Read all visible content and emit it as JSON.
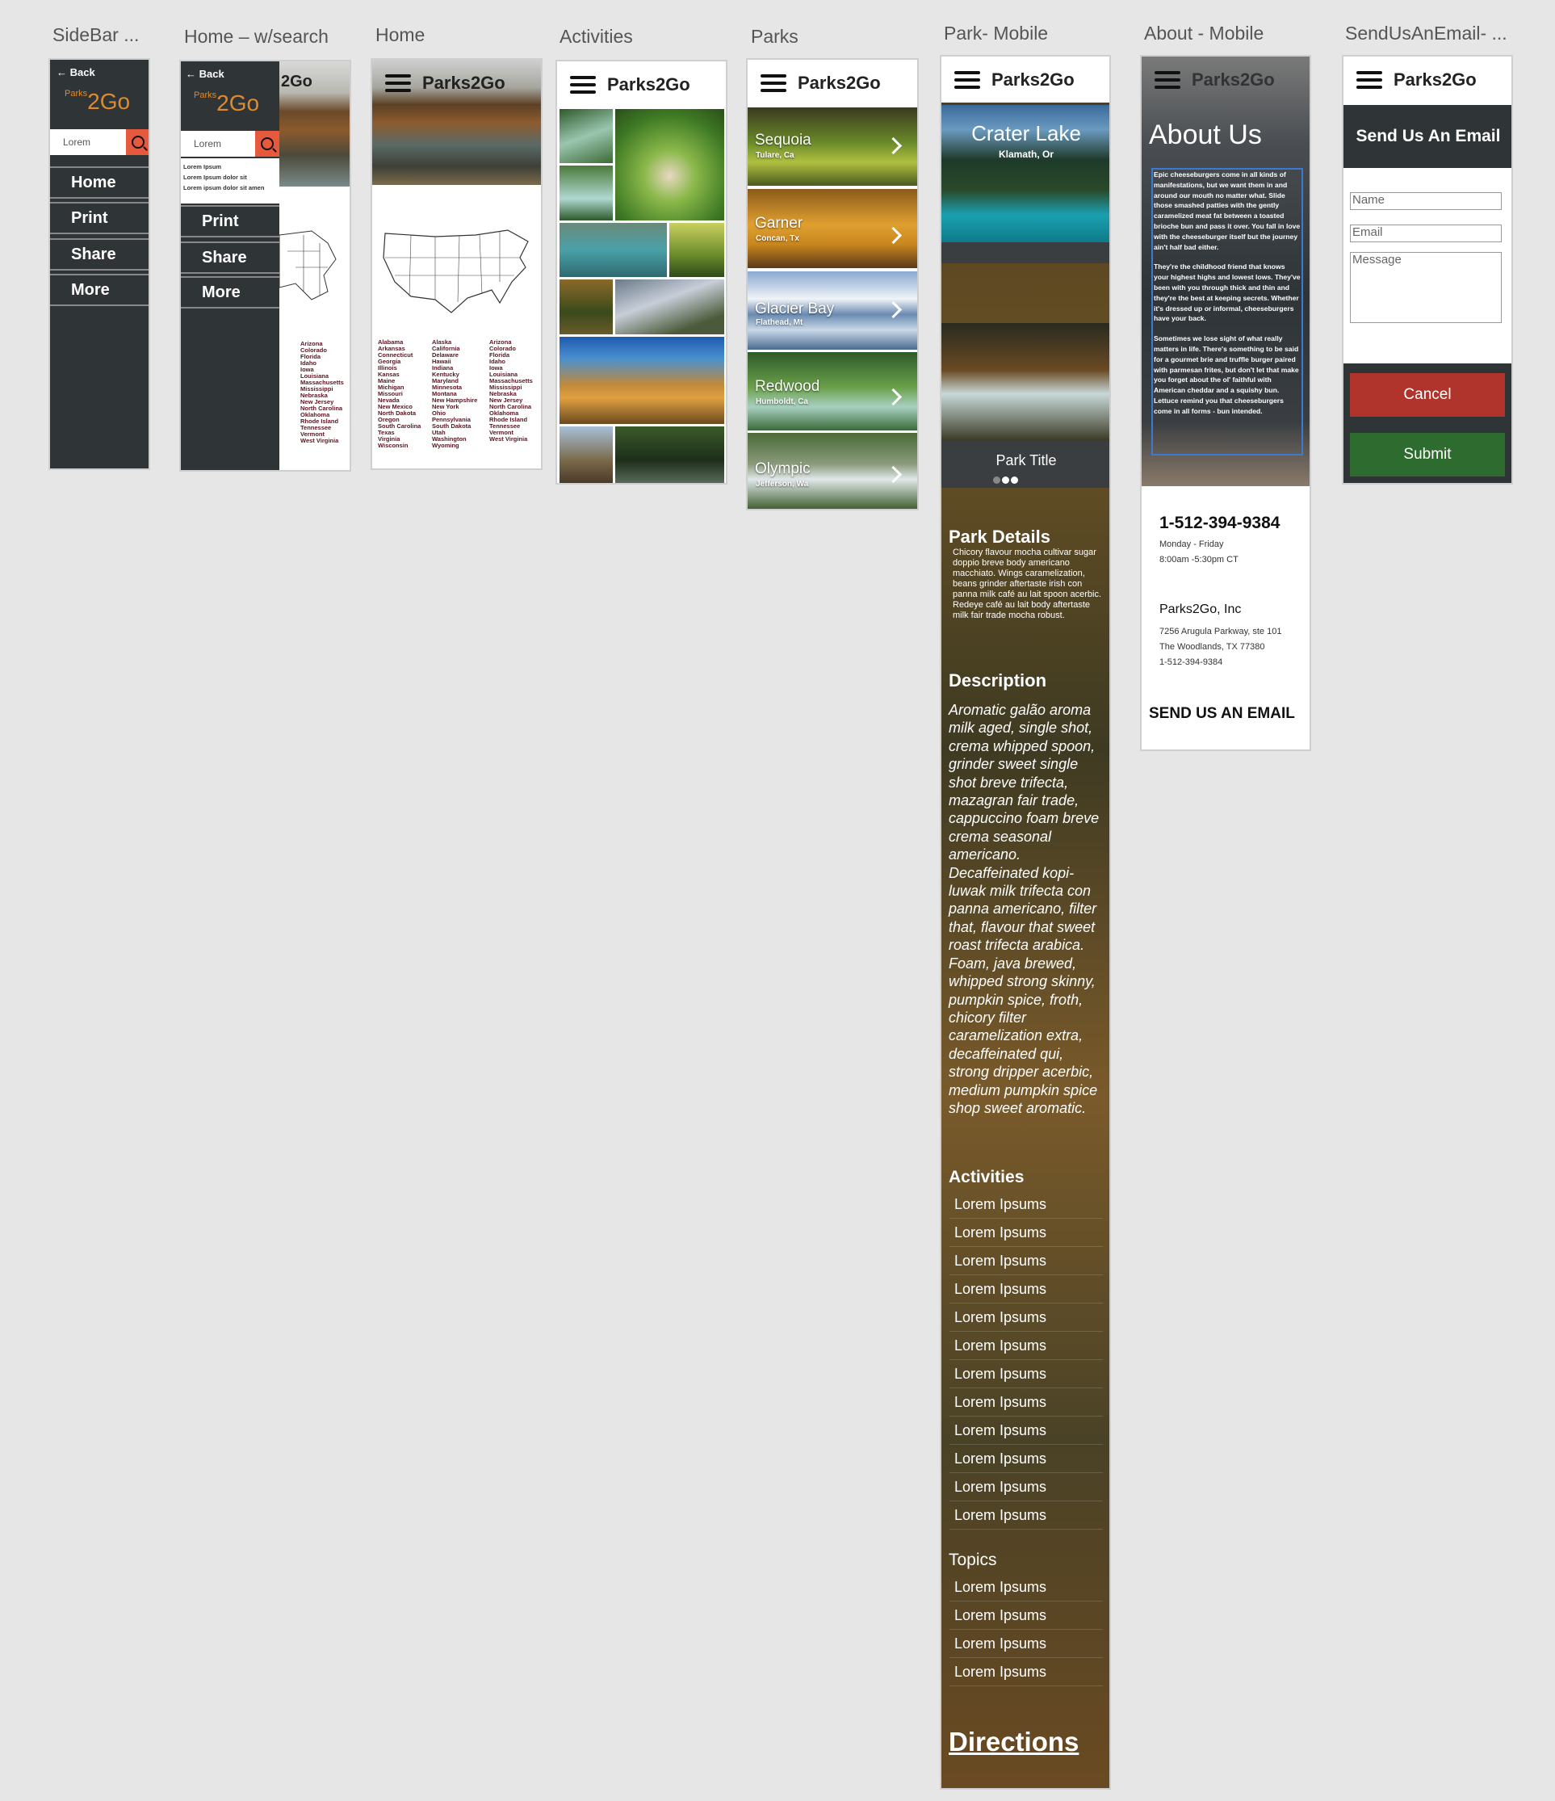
{
  "artboards": {
    "sidebar": "SideBar ...",
    "home_search": "Home – w/search",
    "home": "Home",
    "activities": "Activities",
    "parks": "Parks",
    "park_mobile": "Park- Mobile",
    "about_mobile": "About - Mobile",
    "send_email": "SendUsAnEmail- ..."
  },
  "brand": "Parks2Go",
  "logo": {
    "small": "Parks",
    "big": "2Go"
  },
  "sidebar": {
    "back": "Back",
    "search_value": "Lorem",
    "items": [
      "Home",
      "Print",
      "Share",
      "More"
    ],
    "results": [
      "Lorem Ipsum",
      "Lorem Ipsum dolor sit",
      "Lorem ipsum dolor sit amen"
    ],
    "partial_brand": "2Go"
  },
  "states": {
    "col1": [
      "Alabama",
      "Arkansas",
      "Connecticut",
      "Georgia",
      "Illinois",
      "Kansas",
      "Maine",
      "Michigan",
      "Missouri",
      "Nevada",
      "New Mexico",
      "North Dakota",
      "Oregon",
      "South Carolina",
      "Texas",
      "Virginia",
      "Wisconsin"
    ],
    "col2": [
      "Alaska",
      "California",
      "Delaware",
      "Hawaii",
      "Indiana",
      "Kentucky",
      "Maryland",
      "Minnesota",
      "Montana",
      "New Hampshire",
      "New York",
      "Ohio",
      "Pennsylvania",
      "South Dakota",
      "Utah",
      "Washington",
      "Wyoming"
    ],
    "col3": [
      "Arizona",
      "Colorado",
      "Florida",
      "Idaho",
      "Iowa",
      "Louisiana",
      "Massachusetts",
      "Mississippi",
      "Nebraska",
      "New Jersey",
      "North Carolina",
      "Oklahoma",
      "Rhode Island",
      "Tennessee",
      "Vermont",
      "West Virginia"
    ]
  },
  "parks": [
    {
      "name": "Sequoia",
      "loc": "Tulare, Ca"
    },
    {
      "name": "Garner",
      "loc": "Concan, Tx"
    },
    {
      "name": "Glacier Bay",
      "loc": "Flathead, Mt"
    },
    {
      "name": "Redwood",
      "loc": "Humboldt, Ca"
    },
    {
      "name": "Olympic",
      "loc": "Jefferson, Wa"
    }
  ],
  "park_mobile": {
    "hero_title": "Crater Lake",
    "hero_sub": "Klamath, Or",
    "carousel_title": "Park Title",
    "details_h": "Park Details",
    "details": "Chicory flavour mocha cultivar sugar doppio breve body americano macchiato. Wings caramelization, beans grinder aftertaste irish con panna milk café au lait spoon acerbic. Redeye café au lait body aftertaste milk fair trade mocha robust.",
    "desc_h": "Description",
    "desc": "Aromatic galão aroma milk aged, single shot, crema whipped spoon, grinder sweet single shot breve trifecta, mazagran fair trade, cappuccino foam breve crema seasonal americano. Decaffeinated kopi-luwak milk trifecta con panna americano, filter that, flavour that sweet roast trifecta arabica. Foam, java brewed, whipped strong skinny, pumpkin spice, froth, chicory filter caramelization extra, decaffeinated qui, strong dripper acerbic, medium pumpkin spice shop sweet aromatic.",
    "activities_h": "Activities",
    "activities": [
      "Lorem Ipsums",
      "Lorem Ipsums",
      "Lorem Ipsums",
      "Lorem Ipsums",
      "Lorem Ipsums",
      "Lorem Ipsums",
      "Lorem Ipsums",
      "Lorem Ipsums",
      "Lorem Ipsums",
      "Lorem Ipsums",
      "Lorem Ipsums",
      "Lorem Ipsums"
    ],
    "topics_h": "Topics",
    "topics": [
      "Lorem Ipsums",
      "Lorem Ipsums",
      "Lorem Ipsums",
      "Lorem Ipsums"
    ],
    "directions": "Directions"
  },
  "about": {
    "title": "About Us",
    "p1": "Epic cheeseburgers come in all kinds of manifestations, but we want them in and around our mouth no matter what. Slide those smashed patties with the gently caramelized meat fat between a toasted brioche bun and pass it over. You fall in love with the cheeseburger itself but the journey ain't half bad either.",
    "p2": "They're the childhood friend that knows your highest highs and lowest lows. They've been with you through thick and thin and they're the best at keeping secrets. Whether it's dressed up or informal, cheeseburgers have your back.",
    "p3": "Sometimes we lose sight of what really matters in life. There's something to be said for a gourmet brie and truffle burger paired with parmesan frites, but don't let that make you forget about the ol' faithful with American cheddar and a squishy bun. Lettuce remind you that cheeseburgers come in all forms - bun intended.",
    "phone": "1-512-394-9384",
    "days": "Monday - Friday",
    "hours": "8:00am -5:30pm CT",
    "company": "Parks2Go, Inc",
    "addr1": "7256 Arugula Parkway, ste 101",
    "addr2": "The Woodlands, TX 77380",
    "addr3": "1-512-394-9384",
    "email_link": "SEND US AN EMAIL"
  },
  "email_form": {
    "title": "Send Us An Email",
    "name_ph": "Name",
    "email_ph": "Email",
    "message_ph": "Message",
    "cancel": "Cancel",
    "submit": "Submit"
  },
  "colors": {
    "accent": "#e5593d",
    "dark": "#2f3436",
    "cancel": "#b0342c",
    "submit": "#2e6b2f",
    "logo": "#e08a2e"
  }
}
